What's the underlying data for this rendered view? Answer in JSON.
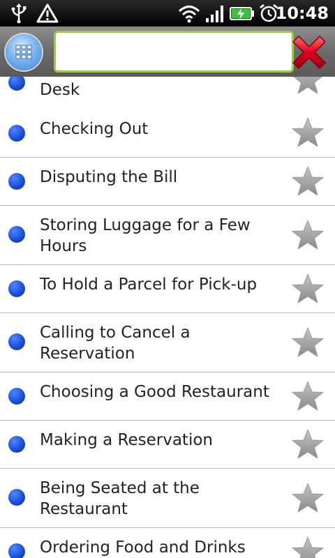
{
  "status_bar": {
    "time": "10:48",
    "icons": [
      "usb-icon",
      "warning-icon",
      "wifi-icon",
      "signal-icon",
      "battery-charging-icon",
      "alarm-icon"
    ]
  },
  "toolbar": {
    "menu_icon": "grid-icon",
    "search": {
      "value": "",
      "placeholder": ""
    },
    "close_icon": "close-x-icon",
    "colors": {
      "search_border": "#9ccc3c",
      "close": "#e0001a",
      "menu": "#3b82d6"
    }
  },
  "list": {
    "bullet_color": "#1a4fd8",
    "items": [
      {
        "label": "Desk"
      },
      {
        "label": "Checking Out"
      },
      {
        "label": "Disputing the Bill"
      },
      {
        "label": "Storing Luggage for a Few Hours"
      },
      {
        "label": "To Hold a Parcel for Pick-up"
      },
      {
        "label": "Calling to Cancel a Reservation"
      },
      {
        "label": "Choosing a Good Restaurant"
      },
      {
        "label": "Making a Reservation"
      },
      {
        "label": "Being Seated at the Restaurant"
      },
      {
        "label": "Ordering Food and Drinks"
      }
    ]
  }
}
